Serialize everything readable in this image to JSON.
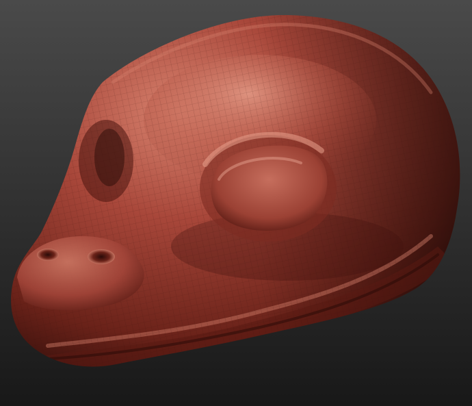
{
  "colors": {
    "bg_top": "#4a4a4a",
    "bg_bottom": "#181818",
    "clay_mid": "#a8473a",
    "clay_light": "#d98470",
    "clay_dark": "#4f1712",
    "clay_shadow": "#2a0b08",
    "wire": "#3a100c"
  },
  "subject": {
    "name": "sculpted-reptile-head",
    "material": "red-clay-matcap",
    "wireframe": true
  }
}
